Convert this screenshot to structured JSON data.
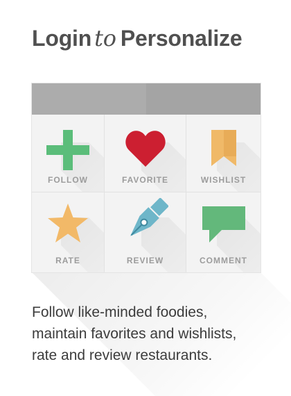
{
  "title": {
    "part1": "Login",
    "conj": "to",
    "part2": "Personalize"
  },
  "features": [
    {
      "label": "FOLLOW",
      "icon": "plus-icon",
      "color": "#5bbd7a"
    },
    {
      "label": "FAVORITE",
      "icon": "heart-icon",
      "color": "#cc1f31"
    },
    {
      "label": "WISHLIST",
      "icon": "bookmark-icon",
      "color": "#f0b968"
    },
    {
      "label": "RATE",
      "icon": "star-icon",
      "color": "#f2b968"
    },
    {
      "label": "REVIEW",
      "icon": "pen-nib-icon",
      "color": "#6eb6c9"
    },
    {
      "label": "COMMENT",
      "icon": "speech-bubble-icon",
      "color": "#63b87b"
    }
  ],
  "description": {
    "line1": "Follow like-minded foodies,",
    "line2": "maintain favorites and wishlists,",
    "line3": "rate and review restaurants."
  }
}
